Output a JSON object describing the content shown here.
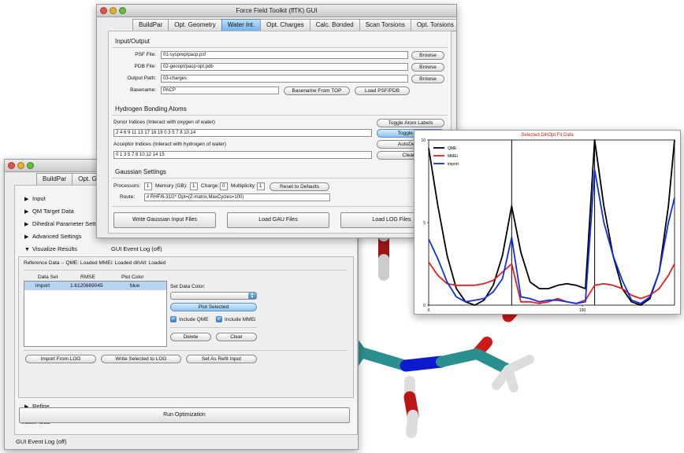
{
  "main_window": {
    "title": "Force Field Toolkit (ffTK) GUI",
    "tabs": [
      "BuildPar",
      "Opt. Geometry",
      "Water Int.",
      "Opt. Charges",
      "Calc. Bonded",
      "Scan Torsions",
      "Opt. Torsions"
    ],
    "io": {
      "heading": "Input/Output",
      "psf_label": "PSF File:",
      "psf_value": "01-sysprep/pacp.psf",
      "pdb_label": "PDB File:",
      "pdb_value": "02-geoopt/pacp-opt.pdb",
      "out_label": "Output Path:",
      "out_value": "03-charges",
      "base_label": "Basename:",
      "base_value": "PACP",
      "browse": "Browse",
      "basename_from_top": "Basename From TOP",
      "load_psf_pdb": "Load PSF/PDB"
    },
    "hb": {
      "heading": "Hydrogen Bonding Atoms",
      "donor_label": "Donor Indices (Interact with oxygen of water)",
      "donor_value": "2 4 6 9 11 13 17 18 19 0 3 5 7 8 10 14",
      "acceptor_label": "Acceptor Indices (Interact with hydrogen of water)",
      "acceptor_value": "0 1 3 5 7 8 10 12 14 15",
      "toggle_atom_labels": "Toggle Atom Labels",
      "toggle_spheres": "Toggle Sph",
      "autodetect": "AutoDetect",
      "clear": "Clear L"
    },
    "gaussian": {
      "heading": "Gaussian Settings",
      "proc_label": "Processors:",
      "proc_value": "1",
      "mem_label": "Memory (GB):",
      "mem_value": "1",
      "charge_label": "Charge:",
      "charge_value": "0",
      "mult_label": "Multiplicity:",
      "mult_value": "1",
      "reset": "Reset to Defaults",
      "route_label": "Route:",
      "route_value": "# RHF/6-31G* Opt=(Z-matrix,MaxCycles=100)"
    },
    "actions": {
      "write": "Write Gaussian Input Files",
      "load_gau": "Load GAU Files",
      "load_log": "Load LOG Files"
    }
  },
  "second_window": {
    "tabs": [
      "BuildPar",
      "Opt. Geome"
    ],
    "sections": [
      "Input",
      "QM Target Data",
      "Dihedral Parameter Settin",
      "Advanced Settings"
    ],
    "visualize": "Visualize Results",
    "gui_log_inline": "GUI Event Log (off)",
    "ref_data": "Reference Data --  QME: Loaded MMEi: Loaded dihAll: Loaded",
    "table": {
      "headers": [
        "Data Set",
        "RMSE",
        "Plot Color"
      ],
      "rows": [
        {
          "set": "import",
          "rmse": "1.6120669045",
          "color": "blue"
        }
      ]
    },
    "set_color_label": "Set Data Color:",
    "plot_selected": "Plot Selected",
    "include_qme": "Include QME",
    "include_mmei": "Include MMEi",
    "delete": "Delete",
    "clear": "Clear",
    "import_from_log": "Import From LOG",
    "write_selected": "Write Selected to LOG",
    "set_refit": "Set As Refit Input",
    "refine": "Refine",
    "status": "Status: IDLE",
    "run": "Run Optimization",
    "gui_log_bottom": "GUI Event Log (off)"
  },
  "plot_window": {
    "title": "Selected DihOpt Fit Data",
    "chart_data": {
      "type": "line",
      "title": "Selected DihOpt Fit Data",
      "x_ticks": [
        "0",
        "100"
      ],
      "y_ticks": [
        "10",
        "5",
        "0"
      ],
      "xlim": [
        0,
        160
      ],
      "ylim": [
        0,
        10
      ],
      "legend_position": "top-left",
      "series": [
        {
          "name": "QME",
          "color": "#000000",
          "x": [
            0,
            6,
            12,
            18,
            24,
            30,
            36,
            42,
            48,
            54,
            60,
            66,
            72,
            78,
            84,
            90,
            96,
            102,
            108,
            114,
            120,
            126,
            132,
            138,
            144,
            150,
            156,
            160
          ],
          "y": [
            9.5,
            6,
            3,
            1,
            0.2,
            0,
            0.3,
            1.2,
            3,
            6,
            3.2,
            1.4,
            1,
            1,
            1.2,
            1.3,
            1.2,
            1,
            10,
            6,
            3,
            1,
            0.2,
            0,
            0.4,
            2,
            6,
            10
          ]
        },
        {
          "name": "MMEi",
          "color": "#e02020",
          "x": [
            0,
            6,
            12,
            18,
            24,
            30,
            36,
            42,
            48,
            54,
            60,
            66,
            72,
            78,
            84,
            90,
            96,
            102,
            108,
            114,
            120,
            126,
            132,
            138,
            144,
            150,
            156,
            160
          ],
          "y": [
            2.6,
            1.8,
            1.3,
            1.2,
            1.2,
            1.2,
            1.3,
            1.5,
            2.0,
            2.5,
            0.2,
            0.2,
            0.1,
            0.2,
            0.4,
            0.2,
            0.1,
            0.3,
            1.2,
            1.3,
            1.2,
            1.0,
            0.6,
            0.4,
            0.6,
            1.0,
            1.8,
            2.5
          ]
        },
        {
          "name": "import",
          "color": "#1030e0",
          "x": [
            0,
            6,
            12,
            18,
            24,
            30,
            36,
            42,
            48,
            54,
            60,
            66,
            72,
            78,
            84,
            90,
            96,
            102,
            108,
            114,
            120,
            126,
            132,
            138,
            144,
            150,
            156,
            160
          ],
          "y": [
            4,
            2.8,
            1.4,
            0.5,
            0.2,
            0.3,
            0.4,
            0.8,
            1.6,
            4.1,
            0.5,
            0.4,
            0.2,
            0.3,
            0.3,
            0.2,
            0.1,
            0.2,
            8.2,
            5,
            3,
            1.5,
            0.3,
            0.1,
            0.5,
            2,
            5,
            6.5
          ]
        }
      ]
    }
  }
}
